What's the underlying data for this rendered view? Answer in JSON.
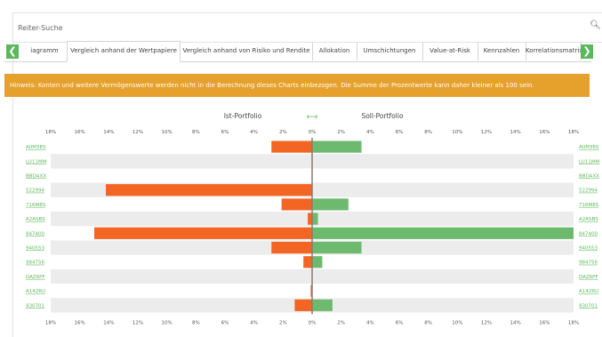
{
  "search": {
    "label": "Reiter-Suche"
  },
  "tabs": [
    {
      "label": "iagramm",
      "active": false
    },
    {
      "label": "Vergleich anhand der Wertpapiere",
      "active": true
    },
    {
      "label": "Vergleich anhand von Risiko und Rendite",
      "active": false
    },
    {
      "label": "Allokation",
      "active": false
    },
    {
      "label": "Umschichtungen",
      "active": false
    },
    {
      "label": "Value-at-Risk",
      "active": false
    },
    {
      "label": "Kennzahlen",
      "active": false
    },
    {
      "label": "Korrelationsmatrix",
      "active": false
    }
  ],
  "nav": {
    "left": "❮",
    "right": "❯"
  },
  "hint": {
    "text": "Hinweis: Konten und weitere Vermögenswerte werden nicht in die Berechnung dieses Charts einbezogen. Die Summe der Prozentwerte kann daher kleiner als 100 sein."
  },
  "colors": {
    "ist": "#f26522",
    "soll": "#6dba6f",
    "accent": "#5cb85c",
    "hint": "#e6a02c",
    "stripe": "#ececec"
  },
  "chart_data": {
    "type": "bar",
    "legend": {
      "left": "Ist-Portfolio",
      "right": "Soll-Portfolio",
      "swap_icon": "⟷"
    },
    "ticks": [
      "18%",
      "16%",
      "14%",
      "12%",
      "10%",
      "8%",
      "6%",
      "4%",
      "2%",
      "0%",
      "2%",
      "4%",
      "6%",
      "8%",
      "10%",
      "12%",
      "14%",
      "16%",
      "18%"
    ],
    "xlim": [
      -18,
      18
    ],
    "categories": [
      "A0M3E0",
      "LU11MM",
      "BBDAXX",
      "522994",
      "716M8S",
      "A2ASBS",
      "847400",
      "940553",
      "984756",
      "DAZ6PF",
      "A142RU",
      "930701"
    ],
    "series": [
      {
        "name": "Ist-Portfolio",
        "values": [
          2.8,
          0,
          0,
          14.2,
          2.1,
          0.3,
          15.0,
          2.8,
          0.6,
          0,
          0.1,
          1.2
        ]
      },
      {
        "name": "Soll-Portfolio",
        "values": [
          3.4,
          0,
          0,
          0,
          2.5,
          0.4,
          18.0,
          3.4,
          0.7,
          0,
          0,
          1.4
        ]
      }
    ]
  }
}
